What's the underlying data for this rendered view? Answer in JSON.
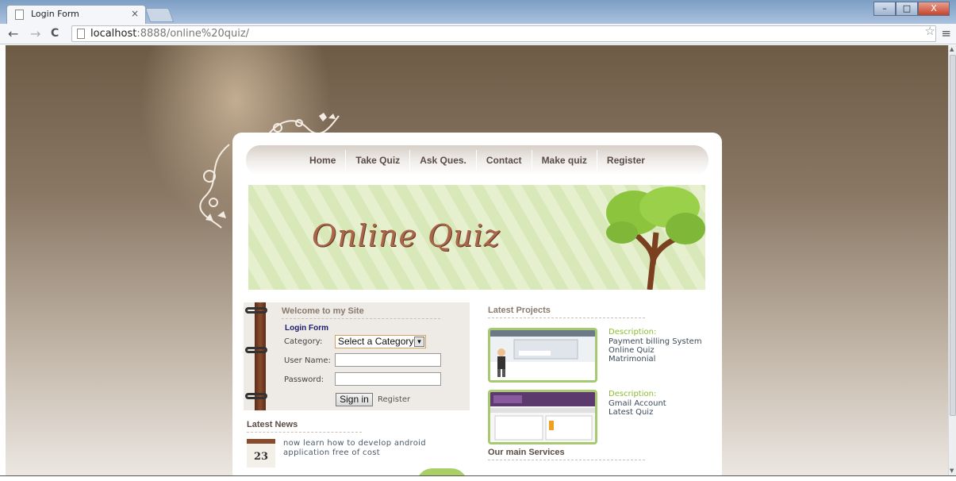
{
  "browser": {
    "tab_title": "Login Form",
    "tab_close": "×",
    "url_host": "localhost",
    "url_rest": ":8888/online%20quiz/",
    "back": "←",
    "forward": "→",
    "reload": "C",
    "star": "☆",
    "menu": "≡",
    "win_min": "–",
    "win_max": "□",
    "win_close": "X"
  },
  "site": {
    "nav": [
      "Home",
      "Take Quiz",
      "Ask Ques.",
      "Contact",
      "Make quiz",
      "Register"
    ],
    "banner_title": "Online Quiz",
    "welcome_heading": "Welcome to my Site",
    "login": {
      "form_label": "Login Form",
      "category_label": "Category:",
      "category_value": "Select a Category",
      "username_label": "User Name:",
      "password_label": "Password:",
      "signin_label": "Sign in",
      "register_link": "Register"
    },
    "news": {
      "heading": "Latest News",
      "day": "23",
      "text": "now learn how to develop android application free of cost"
    },
    "projects": {
      "heading": "Latest Projects",
      "items": [
        {
          "desc_label": "Description:",
          "lines": [
            "Payment billing System",
            "Online Quiz",
            "Matrimonial"
          ]
        },
        {
          "desc_label": "Description:",
          "lines": [
            "Gmail Account",
            "Latest Quiz"
          ]
        }
      ]
    },
    "services_heading": "Our main Services"
  }
}
